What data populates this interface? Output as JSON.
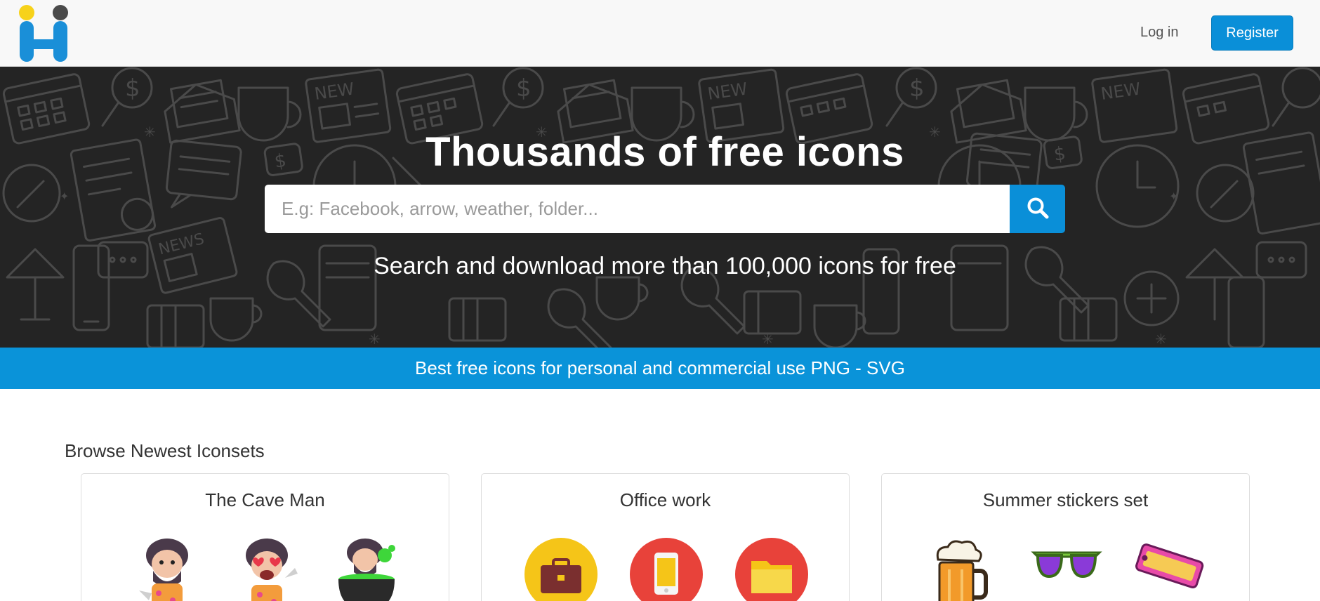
{
  "nav": {
    "login_label": "Log in",
    "register_label": "Register"
  },
  "hero": {
    "title": "Thousands of free icons",
    "search_placeholder": "E.g: Facebook, arrow, weather, folder...",
    "subtitle": "Search and download more than 100,000 icons for free"
  },
  "banner": {
    "text": "Best free icons for personal and commercial use PNG - SVG"
  },
  "browse": {
    "title": "Browse Newest Iconsets",
    "cards": [
      {
        "title": "The Cave Man",
        "icons": [
          "caveman-thinking-icon",
          "caveman-love-icon",
          "caveman-cauldron-icon"
        ]
      },
      {
        "title": "Office work",
        "icons": [
          "briefcase-icon",
          "smartphone-icon",
          "folder-icon"
        ]
      },
      {
        "title": "Summer stickers set",
        "icons": [
          "beer-mug-icon",
          "sunglasses-icon",
          "summer-tag-icon"
        ]
      }
    ]
  },
  "colors": {
    "accent": "#0a8fd8",
    "hero_bg": "#242424",
    "banner_bg": "#0a93d9"
  }
}
